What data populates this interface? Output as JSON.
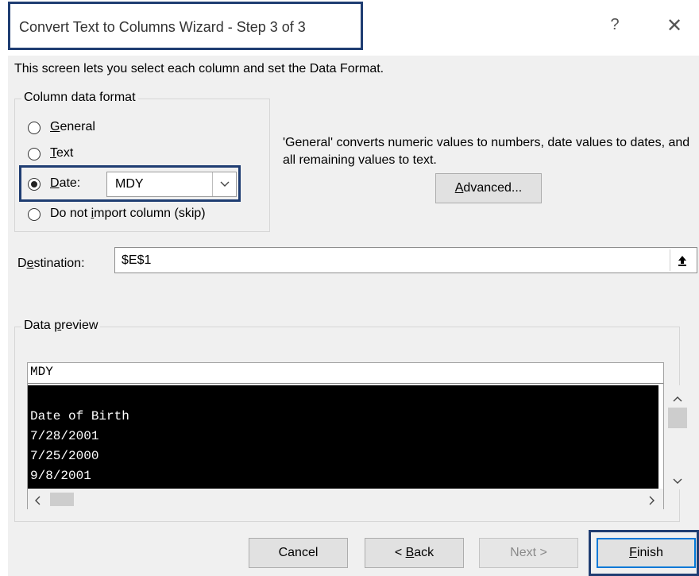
{
  "window": {
    "title": "Convert Text to Columns Wizard - Step 3 of 3",
    "help_glyph": "?",
    "close_glyph": "✕"
  },
  "intro_text": "This screen lets you select each column and set the Data Format.",
  "column_format": {
    "group_label": "Column data format",
    "options": [
      {
        "key": "general",
        "label": "General",
        "accel": "G",
        "rest": "eneral",
        "checked": false
      },
      {
        "key": "text",
        "label": "Text",
        "accel": "T",
        "rest": "ext",
        "checked": false
      },
      {
        "key": "date",
        "label": "Date:",
        "accel": "D",
        "rest": "ate:",
        "checked": true
      },
      {
        "key": "skip",
        "label": "Do not import column (skip)",
        "pre": "Do not ",
        "accel": "i",
        "rest": "mport column (skip)",
        "checked": false
      }
    ],
    "date_select": {
      "value": "MDY"
    }
  },
  "description": "'General' converts numeric values to numbers, date values to dates, and all remaining values to text.",
  "advanced_button": {
    "accel": "A",
    "rest": "dvanced...",
    "label": "Advanced..."
  },
  "destination": {
    "pre": "D",
    "accel": "e",
    "rest": "stination:",
    "label": "Destination:",
    "value": "$E$1",
    "collapse_icon": "collapse-dialog-icon"
  },
  "preview": {
    "group_label": "Data preview",
    "pre": "Data ",
    "accel": "p",
    "rest": "review",
    "column_header": "MDY",
    "rows": [
      "",
      "Date of Birth",
      "7/28/2001",
      "7/25/2000",
      "9/8/2001"
    ]
  },
  "buttons": {
    "cancel": "Cancel",
    "back": {
      "pre": "< ",
      "accel": "B",
      "rest": "ack",
      "label": "< Back"
    },
    "next": "Next >",
    "finish": {
      "accel": "F",
      "rest": "inish",
      "label": "Finish"
    }
  },
  "colors": {
    "highlight": "#1f3d72",
    "dialog_bg": "#f0f0f0",
    "preview_bg": "#000000"
  }
}
